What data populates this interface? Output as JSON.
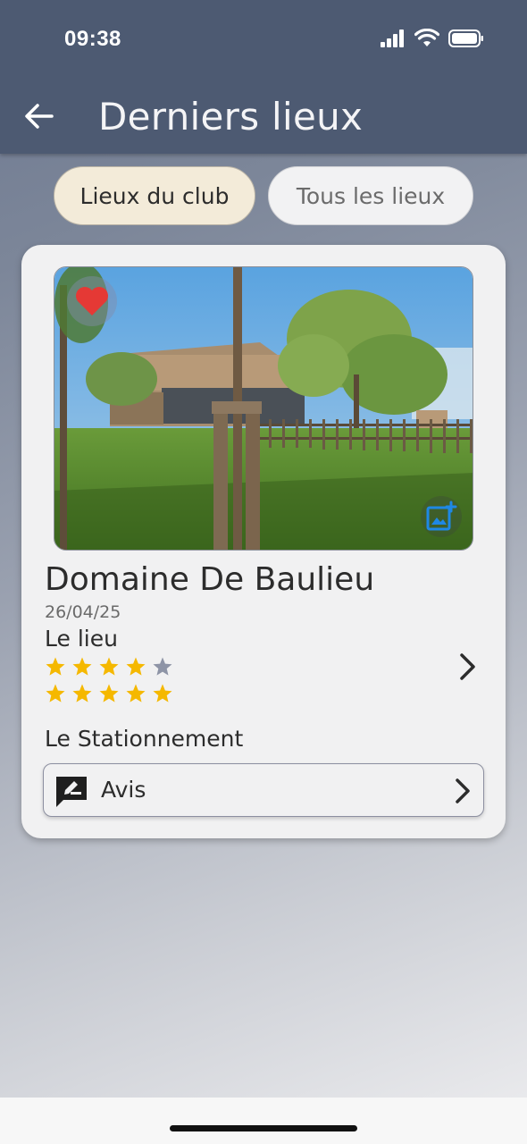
{
  "status_bar": {
    "time": "09:38"
  },
  "header": {
    "title": "Derniers lieux"
  },
  "tabs": [
    {
      "label": "Lieux du club",
      "active": true
    },
    {
      "label": "Tous les lieux",
      "active": false
    }
  ],
  "venue": {
    "name": "Domaine De Baulieu",
    "date": "26/04/25",
    "favorite": true,
    "ratings": [
      {
        "label": "Le lieu",
        "stars": 4,
        "max": 5
      },
      {
        "label": "",
        "stars": 5,
        "max": 5
      }
    ],
    "parking_label": "Le Stationnement",
    "review_button": "Avis"
  },
  "colors": {
    "header_bg": "#4d5a72",
    "tab_active_bg": "#f3ebd9",
    "star_filled": "#f5b800",
    "star_empty": "#8e94a6",
    "heart": "#e53935",
    "add_photo_icon": "#1e88e5"
  },
  "icons": {
    "back": "arrow-left-icon",
    "favorite": "heart-icon",
    "add_photo": "add-photo-icon",
    "chevron": "chevron-right-icon",
    "review": "rate-review-icon"
  }
}
